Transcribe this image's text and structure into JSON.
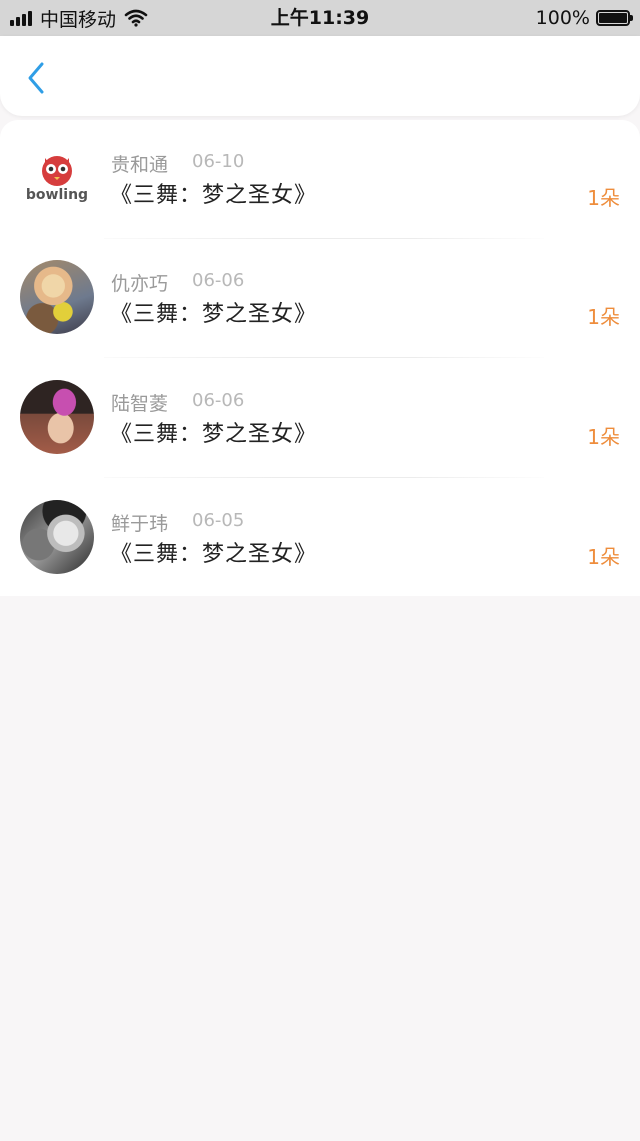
{
  "status_bar": {
    "carrier": "中国移动",
    "time": "上午11:39",
    "battery": "100%"
  },
  "nav": {
    "back_icon": "chevron-left-icon"
  },
  "colors": {
    "accent": "#2f9ee6",
    "count": "#ee8d3c",
    "background": "#f8f6f7"
  },
  "items": [
    {
      "name": "贵和通",
      "date": "06-10",
      "title": "《三舞：梦之圣女》",
      "count": "1朵",
      "avatar": "bowling-logo-avatar",
      "avatar_text": "bowling"
    },
    {
      "name": "仇亦巧",
      "date": "06-06",
      "title": "《三舞：梦之圣女》",
      "count": "1朵",
      "avatar": "photo-avatar"
    },
    {
      "name": "陆智菱",
      "date": "06-06",
      "title": "《三舞：梦之圣女》",
      "count": "1朵",
      "avatar": "photo-avatar"
    },
    {
      "name": "鲜于玮",
      "date": "06-05",
      "title": "《三舞：梦之圣女》",
      "count": "1朵",
      "avatar": "photo-avatar"
    }
  ]
}
